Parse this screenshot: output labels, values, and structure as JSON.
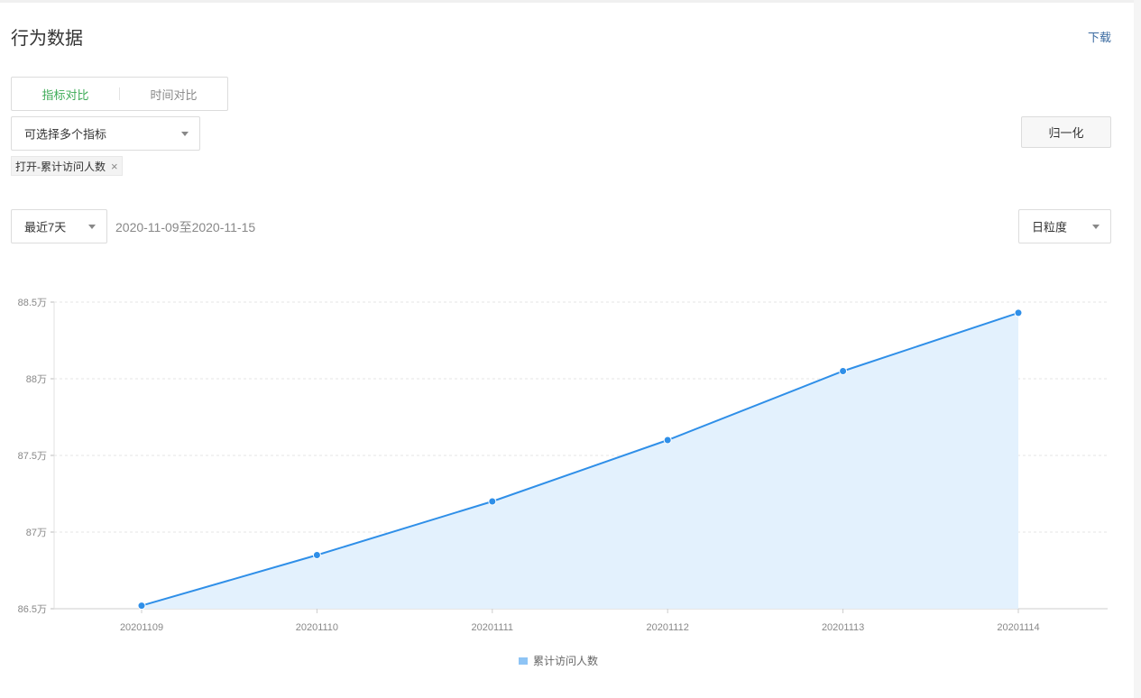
{
  "header": {
    "title": "行为数据",
    "download_label": "下载"
  },
  "compare_tabs": [
    {
      "label": "指标对比",
      "active": true
    },
    {
      "label": "时间对比",
      "active": false
    }
  ],
  "metric_select": {
    "placeholder": "可选择多个指标"
  },
  "normalize_button": "归一化",
  "selected_tags": [
    {
      "label": "打开-累计访问人数"
    }
  ],
  "date_filter": {
    "range_label": "最近7天",
    "range_text": "2020-11-09至2020-11-15"
  },
  "granularity": {
    "label": "日粒度"
  },
  "colors": {
    "line": "#2f8fe8",
    "area": "#e3f1fd",
    "active_tab": "#3dab57",
    "link": "#3a6aa0"
  },
  "chart_data": {
    "type": "area",
    "categories": [
      "20201109",
      "20201110",
      "20201111",
      "20201112",
      "20201113",
      "20201114"
    ],
    "series": [
      {
        "name": "累计访问人数",
        "values": [
          865200,
          868500,
          872000,
          876000,
          880500,
          884300
        ]
      }
    ],
    "y_ticks": [
      "86.5万",
      "87万",
      "87.5万",
      "88万",
      "88.5万"
    ],
    "ylim": [
      865000,
      885000
    ],
    "grid": true,
    "legend_position": "bottom-center"
  }
}
